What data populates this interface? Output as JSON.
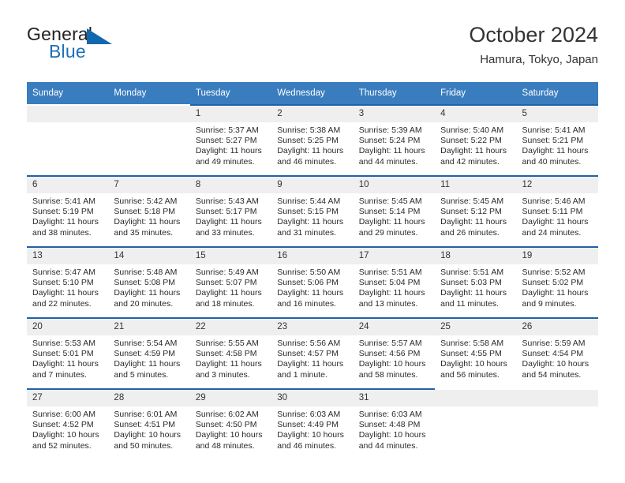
{
  "brand": {
    "name_part1": "General",
    "name_part2": "Blue",
    "triangle_icon": "brand-triangle-icon",
    "accent_color": "#1268ad"
  },
  "header": {
    "title": "October 2024",
    "location": "Hamura, Tokyo, Japan"
  },
  "colors": {
    "header_row_bg": "#3a7dbf",
    "row_separator": "#1f62a8",
    "daynum_bg": "#efefef",
    "text": "#2a2a2a"
  },
  "weekdays": [
    "Sunday",
    "Monday",
    "Tuesday",
    "Wednesday",
    "Thursday",
    "Friday",
    "Saturday"
  ],
  "weeks": [
    [
      {
        "empty": true
      },
      {
        "empty": true
      },
      {
        "day": "1",
        "sunrise": "Sunrise: 5:37 AM",
        "sunset": "Sunset: 5:27 PM",
        "daylight": "Daylight: 11 hours and 49 minutes."
      },
      {
        "day": "2",
        "sunrise": "Sunrise: 5:38 AM",
        "sunset": "Sunset: 5:25 PM",
        "daylight": "Daylight: 11 hours and 46 minutes."
      },
      {
        "day": "3",
        "sunrise": "Sunrise: 5:39 AM",
        "sunset": "Sunset: 5:24 PM",
        "daylight": "Daylight: 11 hours and 44 minutes."
      },
      {
        "day": "4",
        "sunrise": "Sunrise: 5:40 AM",
        "sunset": "Sunset: 5:22 PM",
        "daylight": "Daylight: 11 hours and 42 minutes."
      },
      {
        "day": "5",
        "sunrise": "Sunrise: 5:41 AM",
        "sunset": "Sunset: 5:21 PM",
        "daylight": "Daylight: 11 hours and 40 minutes."
      }
    ],
    [
      {
        "day": "6",
        "sunrise": "Sunrise: 5:41 AM",
        "sunset": "Sunset: 5:19 PM",
        "daylight": "Daylight: 11 hours and 38 minutes."
      },
      {
        "day": "7",
        "sunrise": "Sunrise: 5:42 AM",
        "sunset": "Sunset: 5:18 PM",
        "daylight": "Daylight: 11 hours and 35 minutes."
      },
      {
        "day": "8",
        "sunrise": "Sunrise: 5:43 AM",
        "sunset": "Sunset: 5:17 PM",
        "daylight": "Daylight: 11 hours and 33 minutes."
      },
      {
        "day": "9",
        "sunrise": "Sunrise: 5:44 AM",
        "sunset": "Sunset: 5:15 PM",
        "daylight": "Daylight: 11 hours and 31 minutes."
      },
      {
        "day": "10",
        "sunrise": "Sunrise: 5:45 AM",
        "sunset": "Sunset: 5:14 PM",
        "daylight": "Daylight: 11 hours and 29 minutes."
      },
      {
        "day": "11",
        "sunrise": "Sunrise: 5:45 AM",
        "sunset": "Sunset: 5:12 PM",
        "daylight": "Daylight: 11 hours and 26 minutes."
      },
      {
        "day": "12",
        "sunrise": "Sunrise: 5:46 AM",
        "sunset": "Sunset: 5:11 PM",
        "daylight": "Daylight: 11 hours and 24 minutes."
      }
    ],
    [
      {
        "day": "13",
        "sunrise": "Sunrise: 5:47 AM",
        "sunset": "Sunset: 5:10 PM",
        "daylight": "Daylight: 11 hours and 22 minutes."
      },
      {
        "day": "14",
        "sunrise": "Sunrise: 5:48 AM",
        "sunset": "Sunset: 5:08 PM",
        "daylight": "Daylight: 11 hours and 20 minutes."
      },
      {
        "day": "15",
        "sunrise": "Sunrise: 5:49 AM",
        "sunset": "Sunset: 5:07 PM",
        "daylight": "Daylight: 11 hours and 18 minutes."
      },
      {
        "day": "16",
        "sunrise": "Sunrise: 5:50 AM",
        "sunset": "Sunset: 5:06 PM",
        "daylight": "Daylight: 11 hours and 16 minutes."
      },
      {
        "day": "17",
        "sunrise": "Sunrise: 5:51 AM",
        "sunset": "Sunset: 5:04 PM",
        "daylight": "Daylight: 11 hours and 13 minutes."
      },
      {
        "day": "18",
        "sunrise": "Sunrise: 5:51 AM",
        "sunset": "Sunset: 5:03 PM",
        "daylight": "Daylight: 11 hours and 11 minutes."
      },
      {
        "day": "19",
        "sunrise": "Sunrise: 5:52 AM",
        "sunset": "Sunset: 5:02 PM",
        "daylight": "Daylight: 11 hours and 9 minutes."
      }
    ],
    [
      {
        "day": "20",
        "sunrise": "Sunrise: 5:53 AM",
        "sunset": "Sunset: 5:01 PM",
        "daylight": "Daylight: 11 hours and 7 minutes."
      },
      {
        "day": "21",
        "sunrise": "Sunrise: 5:54 AM",
        "sunset": "Sunset: 4:59 PM",
        "daylight": "Daylight: 11 hours and 5 minutes."
      },
      {
        "day": "22",
        "sunrise": "Sunrise: 5:55 AM",
        "sunset": "Sunset: 4:58 PM",
        "daylight": "Daylight: 11 hours and 3 minutes."
      },
      {
        "day": "23",
        "sunrise": "Sunrise: 5:56 AM",
        "sunset": "Sunset: 4:57 PM",
        "daylight": "Daylight: 11 hours and 1 minute."
      },
      {
        "day": "24",
        "sunrise": "Sunrise: 5:57 AM",
        "sunset": "Sunset: 4:56 PM",
        "daylight": "Daylight: 10 hours and 58 minutes."
      },
      {
        "day": "25",
        "sunrise": "Sunrise: 5:58 AM",
        "sunset": "Sunset: 4:55 PM",
        "daylight": "Daylight: 10 hours and 56 minutes."
      },
      {
        "day": "26",
        "sunrise": "Sunrise: 5:59 AM",
        "sunset": "Sunset: 4:54 PM",
        "daylight": "Daylight: 10 hours and 54 minutes."
      }
    ],
    [
      {
        "day": "27",
        "sunrise": "Sunrise: 6:00 AM",
        "sunset": "Sunset: 4:52 PM",
        "daylight": "Daylight: 10 hours and 52 minutes."
      },
      {
        "day": "28",
        "sunrise": "Sunrise: 6:01 AM",
        "sunset": "Sunset: 4:51 PM",
        "daylight": "Daylight: 10 hours and 50 minutes."
      },
      {
        "day": "29",
        "sunrise": "Sunrise: 6:02 AM",
        "sunset": "Sunset: 4:50 PM",
        "daylight": "Daylight: 10 hours and 48 minutes."
      },
      {
        "day": "30",
        "sunrise": "Sunrise: 6:03 AM",
        "sunset": "Sunset: 4:49 PM",
        "daylight": "Daylight: 10 hours and 46 minutes."
      },
      {
        "day": "31",
        "sunrise": "Sunrise: 6:03 AM",
        "sunset": "Sunset: 4:48 PM",
        "daylight": "Daylight: 10 hours and 44 minutes."
      },
      {
        "empty": true
      },
      {
        "empty": true
      }
    ]
  ]
}
